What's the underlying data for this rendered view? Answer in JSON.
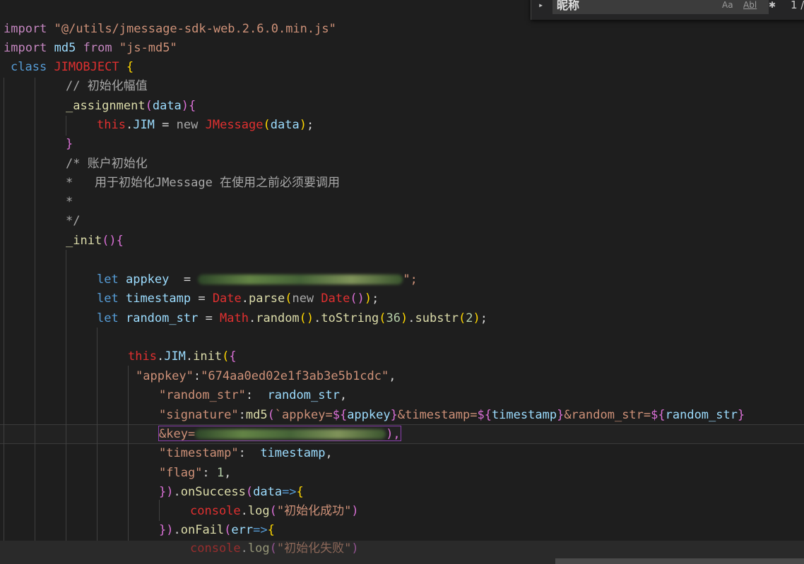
{
  "find_widget": {
    "toggle_glyph": "▸",
    "query": "昵称",
    "match_case_label": "Aa",
    "whole_word_label": "Abl",
    "regex_label": "✱",
    "match_count": "1 /"
  },
  "code": {
    "l1_kw": "import",
    "l1_str": "\"@/utils/jmessage-sdk-web.2.6.0.min.js\"",
    "l2_kw": "import",
    "l2_id": "md5",
    "l2_from": "from",
    "l2_str": "\"js-md5\"",
    "l3_kw": "class",
    "l3_cls": "JIMOBJECT",
    "l3_br": "{",
    "l4_cmt": "// 初始化幅值",
    "l5_fn": "_assignment",
    "l5_p1": "(",
    "l5_arg": "data",
    "l5_p2": ")",
    "l5_br": "{",
    "l6_this": "this",
    "l6_dot": ".",
    "l6_prop": "JIM",
    "l6_eq": " = ",
    "l6_new": "new",
    "l6_cls": "JMessage",
    "l6_p1": "(",
    "l6_arg": "data",
    "l6_p2": ")",
    "l6_semi": ";",
    "l7_br": "}",
    "l8_cmt": "/* 账户初始化",
    "l9_cmt": "*   用于初始化JMessage 在使用之前必须要调用",
    "l10_cmt": "*",
    "l11_cmt": "*/",
    "l12_fn": "_init",
    "l12_p": "()",
    "l12_br": "{",
    "l14_let": "let",
    "l14_id": "appkey",
    "l14_eq": "  = ",
    "l14_str_end": "\";",
    "l15_let": "let",
    "l15_id": "timestamp",
    "l15_eq": " = ",
    "l15_cls": "Date",
    "l15_dot": ".",
    "l15_fn": "parse",
    "l15_p1": "(",
    "l15_new": "new",
    "l15_cls2": "Date",
    "l15_p2": "()",
    "l15_p3": ")",
    "l15_semi": ";",
    "l16_let": "let",
    "l16_id": "random_str",
    "l16_eq": " = ",
    "l16_cls": "Math",
    "l16_dot": ".",
    "l16_fn": "random",
    "l16_p": "()",
    "l16_dot2": ".",
    "l16_fn2": "toString",
    "l16_p1": "(",
    "l16_num": "36",
    "l16_p2": ")",
    "l16_dot3": ".",
    "l16_fn3": "substr",
    "l16_p3": "(",
    "l16_num2": "2",
    "l16_p4": ")",
    "l16_semi": ";",
    "l18_this": "this",
    "l18_dot": ".",
    "l18_prop": "JIM",
    "l18_dot2": ".",
    "l18_fn": "init",
    "l18_p": "(",
    "l18_br": "{",
    "l19_key": "\"appkey\"",
    "l19_colon": ":",
    "l19_val": "\"674aa0ed02e1f3ab3e5b1cdc\"",
    "l19_comma": ",",
    "l20_key": "\"random_str\"",
    "l20_colon": ":  ",
    "l20_val": "random_str",
    "l20_comma": ",",
    "l21_key": "\"signature\"",
    "l21_colon": ":",
    "l21_fn": "md5",
    "l21_p": "(",
    "l21_tpl1": "`appkey=",
    "l21_d1": "${",
    "l21_v1": "appkey",
    "l21_c1": "}",
    "l21_tpl2": "&timestamp=",
    "l21_d2": "${",
    "l21_v2": "timestamp",
    "l21_c2": "}",
    "l21_tpl3": "&random_str=",
    "l21_d3": "${",
    "l21_v3": "random_str",
    "l21_c3": "}",
    "l22_tpl": "&key=",
    "l22_end": "),",
    "l23_key": "\"timestamp\"",
    "l23_colon": ":  ",
    "l23_val": "timestamp",
    "l23_comma": ",",
    "l24_key": "\"flag\"",
    "l24_colon": ": ",
    "l24_num": "1",
    "l24_comma": ",",
    "l25_close": "})",
    "l25_dot": ".",
    "l25_fn": "onSuccess",
    "l25_p": "(",
    "l25_arg": "data",
    "l25_arrow": "=>",
    "l25_br": "{",
    "l26_obj": "console",
    "l26_dot": ".",
    "l26_fn": "log",
    "l26_p1": "(",
    "l26_str": "\"初始化成功\"",
    "l26_p2": ")",
    "l27_close": "})",
    "l27_dot": ".",
    "l27_fn": "onFail",
    "l27_p": "(",
    "l27_arg": "err",
    "l27_arrow": "=>",
    "l27_br": "{",
    "l28_obj": "console",
    "l28_dot": ".",
    "l28_fn": "log",
    "l28_p1": "(",
    "l28_str": "\"初始化失败\"",
    "l28_p2": ")"
  }
}
